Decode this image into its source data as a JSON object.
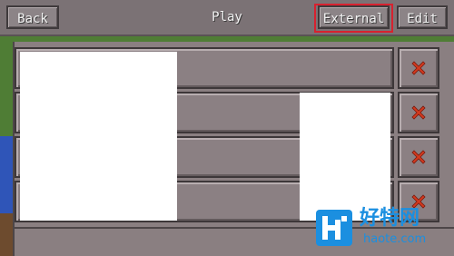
{
  "toolbar": {
    "back_label": "Back",
    "title": "Play",
    "external_label": "External",
    "edit_label": "Edit"
  },
  "worlds": [
    {
      "delete_icon": "x-icon"
    },
    {
      "delete_icon": "x-icon"
    },
    {
      "delete_icon": "x-icon"
    },
    {
      "delete_icon": "x-icon"
    }
  ],
  "watermark": {
    "cn": "好特网",
    "en": "haote.com"
  },
  "colors": {
    "highlight": "#d8212f",
    "delete_x": "#d23a1f",
    "watermark": "#1b8fe0"
  }
}
